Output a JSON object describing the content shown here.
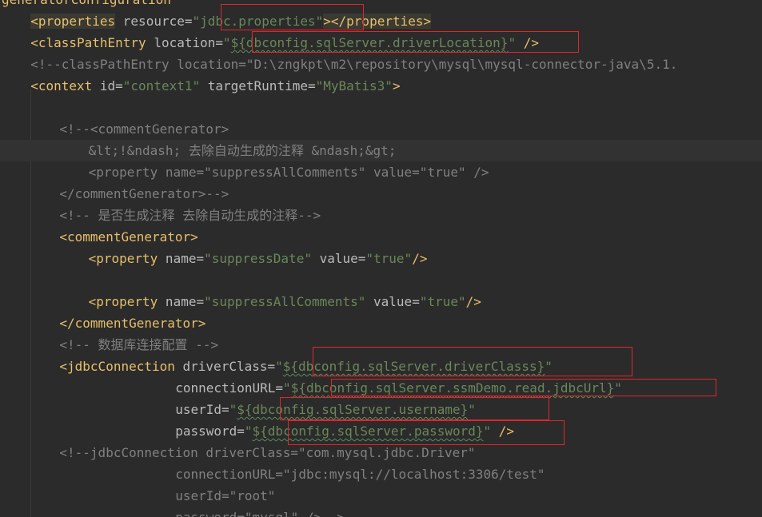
{
  "colors": {
    "background": "#2b2b2b",
    "tag": "#e8bf6a",
    "attribute": "#bababa",
    "string": "#6a8759",
    "comment": "#808080",
    "highlight_box": "#e0262b"
  },
  "lines": [
    {
      "indent": 0,
      "tokens": [
        [
          "t-tag",
          "generatorConfiguration"
        ]
      ]
    },
    {
      "indent": 4,
      "tokens": [
        [
          "t-tag tag-hl",
          "<properties"
        ],
        [
          "t-attr",
          " resource="
        ],
        [
          "t-val",
          "\""
        ],
        [
          "t-val",
          "jdbc.properties"
        ],
        [
          "t-val",
          "\""
        ],
        [
          "t-tag tag-hl",
          "></properties>"
        ]
      ]
    },
    {
      "indent": 4,
      "tokens": [
        [
          "t-tag",
          "<classPathEntry"
        ],
        [
          "t-attr",
          " location="
        ],
        [
          "t-val",
          "\""
        ],
        [
          "t-val squig",
          "${dbconfig.sqlServer.driverLocation}"
        ],
        [
          "t-val",
          "\""
        ],
        [
          "t-tag",
          " />"
        ]
      ]
    },
    {
      "indent": 4,
      "tokens": [
        [
          "t-com",
          "<!--classPathEntry location=\"D:\\zngkpt\\m2\\repository\\mysql\\mysql-connector-java\\5.1."
        ]
      ]
    },
    {
      "indent": 4,
      "tokens": [
        [
          "t-tag",
          "<context"
        ],
        [
          "t-attr",
          " id="
        ],
        [
          "t-val",
          "\"context1\""
        ],
        [
          "t-attr",
          " targetRuntime="
        ],
        [
          "t-val",
          "\"MyBatis3\""
        ],
        [
          "t-tag",
          ">"
        ]
      ]
    },
    {
      "indent": 0,
      "tokens": []
    },
    {
      "indent": 8,
      "tokens": [
        [
          "t-com",
          "<!--<commentGenerator>"
        ]
      ]
    },
    {
      "indent": 12,
      "caret": true,
      "tokens": [
        [
          "t-com",
          "&lt;!&ndash; 去除自动生成的注释 &ndash;&gt;"
        ]
      ]
    },
    {
      "indent": 12,
      "tokens": [
        [
          "t-com",
          "<property name=\"suppressAllComments\" value=\"true\" />"
        ]
      ]
    },
    {
      "indent": 8,
      "tokens": [
        [
          "t-com",
          "</commentGenerator>-->"
        ]
      ]
    },
    {
      "indent": 8,
      "tokens": [
        [
          "t-com",
          "<!-- 是否生成注释 去除自动生成的注释-->"
        ]
      ]
    },
    {
      "indent": 8,
      "tokens": [
        [
          "t-tag",
          "<commentGenerator>"
        ]
      ]
    },
    {
      "indent": 12,
      "tokens": [
        [
          "t-tag",
          "<property"
        ],
        [
          "t-attr",
          " name="
        ],
        [
          "t-val",
          "\"suppressDate\""
        ],
        [
          "t-attr",
          " value="
        ],
        [
          "t-val",
          "\"true\""
        ],
        [
          "t-tag",
          "/>"
        ]
      ]
    },
    {
      "indent": 0,
      "tokens": []
    },
    {
      "indent": 12,
      "tokens": [
        [
          "t-tag",
          "<property"
        ],
        [
          "t-attr",
          " name="
        ],
        [
          "t-val",
          "\"suppressAllComments\""
        ],
        [
          "t-attr",
          " value="
        ],
        [
          "t-val",
          "\"true\""
        ],
        [
          "t-tag",
          "/>"
        ]
      ]
    },
    {
      "indent": 8,
      "tokens": [
        [
          "t-tag",
          "</commentGenerator>"
        ]
      ]
    },
    {
      "indent": 8,
      "tokens": [
        [
          "t-com",
          "<!-- 数据库连接配置 -->"
        ]
      ]
    },
    {
      "indent": 8,
      "tokens": [
        [
          "t-tag",
          "<jdbcConnection"
        ],
        [
          "t-attr",
          " driverClass="
        ],
        [
          "t-val",
          "\""
        ],
        [
          "t-val squig",
          "${dbconfig.sqlServer.driverClasss}"
        ],
        [
          "t-val",
          "\""
        ]
      ]
    },
    {
      "indent": 24,
      "tokens": [
        [
          "t-attr",
          "connectionURL="
        ],
        [
          "t-val",
          "\""
        ],
        [
          "t-val squig",
          "${dbconfig.sqlServer.ssmDemo.read.jdbcUrl}"
        ],
        [
          "t-val",
          "\""
        ]
      ]
    },
    {
      "indent": 24,
      "tokens": [
        [
          "t-attr",
          "userId="
        ],
        [
          "t-val",
          "\""
        ],
        [
          "t-val squig",
          "${dbconfig.sqlServer.username}"
        ],
        [
          "t-val",
          "\""
        ]
      ]
    },
    {
      "indent": 24,
      "tokens": [
        [
          "t-attr",
          "password="
        ],
        [
          "t-val",
          "\""
        ],
        [
          "t-val squig",
          "${dbconfig.sqlServer.password}"
        ],
        [
          "t-val",
          "\""
        ],
        [
          "t-tag",
          " />"
        ]
      ]
    },
    {
      "indent": 8,
      "tokens": [
        [
          "t-com",
          "<!--jdbcConnection driverClass=\"com.mysql.jdbc.Driver\""
        ]
      ]
    },
    {
      "indent": 24,
      "tokens": [
        [
          "t-com",
          "connectionURL=\"jdbc:mysql://localhost:3306/test\""
        ]
      ]
    },
    {
      "indent": 24,
      "tokens": [
        [
          "t-com",
          "userId=\"root\""
        ]
      ]
    },
    {
      "indent": 24,
      "tokens": [
        [
          "t-com",
          "password=\"mysql\" />-->"
        ]
      ]
    }
  ]
}
